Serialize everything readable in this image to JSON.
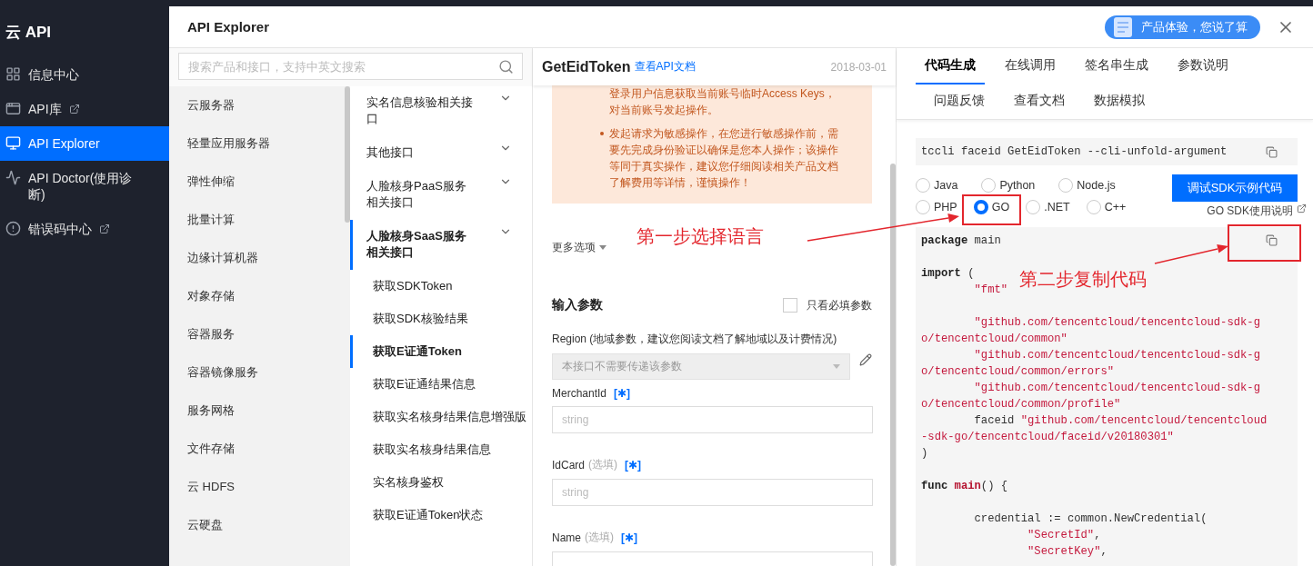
{
  "nav": {
    "title": "云 API",
    "items": [
      {
        "label": "信息中心",
        "external": false,
        "selected": false
      },
      {
        "label": "API库",
        "external": true,
        "selected": false
      },
      {
        "label": "API Explorer",
        "external": false,
        "selected": true
      },
      {
        "label": "API Doctor(使用诊断)",
        "external": false,
        "selected": false
      },
      {
        "label": "错误码中心",
        "external": true,
        "selected": false
      }
    ]
  },
  "header": {
    "title": "API Explorer",
    "banner": "产品体验，您说了算"
  },
  "search": {
    "placeholder": "搜索产品和接口，支持中英文搜索"
  },
  "products": [
    "云服务器",
    "轻量应用服务器",
    "弹性伸缩",
    "批量计算",
    "边缘计算机器",
    "对象存储",
    "容器服务",
    "容器镜像服务",
    "服务网格",
    "文件存储",
    "云 HDFS",
    "云硬盘"
  ],
  "api_groups": [
    {
      "label": "实名信息核验相关接口",
      "selected": false
    },
    {
      "label": "其他接口",
      "selected": false
    },
    {
      "label": "人脸核身PaaS服务相关接口",
      "selected": false
    },
    {
      "label": "人脸核身SaaS服务相关接口",
      "selected": true,
      "children": [
        {
          "label": "获取SDKToken",
          "selected": false
        },
        {
          "label": "获取SDK核验结果",
          "selected": false
        },
        {
          "label": "获取E证通Token",
          "selected": true
        },
        {
          "label": "获取E证通结果信息",
          "selected": false
        },
        {
          "label": "获取实名核身结果信息增强版",
          "selected": false
        },
        {
          "label": "获取实名核身结果信息",
          "selected": false
        },
        {
          "label": "实名核身鉴权",
          "selected": false
        },
        {
          "label": "获取E证通Token状态",
          "selected": false
        }
      ]
    }
  ],
  "api": {
    "name": "GetEidToken",
    "doc_link": "查看API文档",
    "date": "2018-03-01",
    "notices": [
      {
        "kind": "continued",
        "text": "登录用户信息获取当前账号临时Access Keys，对当前账号发起操作。"
      },
      {
        "kind": "bullet",
        "text": "发起请求为敏感操作，在您进行敏感操作前，需要先完成身份验证以确保是您本人操作；该操作等同于真实操作，建议您仔细阅读相关产品文档了解费用等详情，谨慎操作！"
      }
    ],
    "more_options": "更多选项",
    "params_title": "输入参数",
    "required_only": {
      "label": "只看必填参数",
      "checked": false
    },
    "region": {
      "label": "Region (地域参数，建议您阅读文档了解地域以及计费情况)",
      "value": "本接口不需要传递该参数",
      "disabled": true
    },
    "fields": [
      {
        "name": "MerchantId",
        "mark": "[✱]",
        "placeholder": "string"
      },
      {
        "name": "IdCard",
        "note": "(选填)",
        "mark": "[✱]",
        "placeholder": "string"
      },
      {
        "name": "Name",
        "note": "(选填)",
        "mark": "[✱]"
      }
    ]
  },
  "tab_rows": [
    [
      {
        "label": "代码生成",
        "selected": true
      },
      {
        "label": "在线调用",
        "selected": false
      },
      {
        "label": "签名串生成",
        "selected": false
      },
      {
        "label": "参数说明",
        "selected": false
      }
    ],
    [
      {
        "label": "问题反馈",
        "selected": false
      },
      {
        "label": "查看文档",
        "selected": false
      },
      {
        "label": "数据模拟",
        "selected": false
      }
    ]
  ],
  "cli_command": "tccli faceid GetEidToken --cli-unfold-argument",
  "language_rows": [
    [
      {
        "label": "Java",
        "selected": false
      },
      {
        "label": "Python",
        "selected": false
      },
      {
        "label": "Node.js",
        "selected": false
      }
    ],
    [
      {
        "label": "PHP",
        "selected": false
      },
      {
        "label": "GO",
        "selected": true
      },
      {
        "label": ".NET",
        "selected": false
      },
      {
        "label": "C++",
        "selected": false
      }
    ]
  ],
  "debug_button": "调试SDK示例代码",
  "sdk_doc_link": "GO SDK使用说明",
  "code_lines": [
    {
      "kind": "flush",
      "tokens": [
        {
          "kind": "keyword",
          "t": "package"
        },
        {
          "kind": "plain",
          "t": " main"
        }
      ]
    },
    {
      "kind": "blank"
    },
    {
      "kind": "flush",
      "tokens": [
        {
          "kind": "keyword",
          "t": "import"
        },
        {
          "kind": "plain",
          "t": " ("
        }
      ]
    },
    {
      "kind": "tab",
      "tokens": [
        {
          "kind": "string",
          "t": "\"fmt\""
        }
      ]
    },
    {
      "kind": "blank"
    },
    {
      "kind": "tab",
      "tokens": [
        {
          "kind": "string",
          "t": "\"github.com/tencentcloud/tencentcloud-sdk-g"
        }
      ]
    },
    {
      "kind": "flush",
      "tokens": [
        {
          "kind": "string",
          "t": "o/tencentcloud/common\""
        }
      ]
    },
    {
      "kind": "tab",
      "tokens": [
        {
          "kind": "string",
          "t": "\"github.com/tencentcloud/tencentcloud-sdk-g"
        }
      ]
    },
    {
      "kind": "flush",
      "tokens": [
        {
          "kind": "string",
          "t": "o/tencentcloud/common/errors\""
        }
      ]
    },
    {
      "kind": "tab",
      "tokens": [
        {
          "kind": "string",
          "t": "\"github.com/tencentcloud/tencentcloud-sdk-g"
        }
      ]
    },
    {
      "kind": "flush",
      "tokens": [
        {
          "kind": "string",
          "t": "o/tencentcloud/common/profile\""
        }
      ]
    },
    {
      "kind": "tab",
      "tokens": [
        {
          "kind": "plain",
          "t": "faceid "
        },
        {
          "kind": "string",
          "t": "\"github.com/tencentcloud/tencentcloud"
        }
      ]
    },
    {
      "kind": "flush",
      "tokens": [
        {
          "kind": "string",
          "t": "-sdk-go/tencentcloud/faceid/v20180301\""
        }
      ]
    },
    {
      "kind": "flush",
      "tokens": [
        {
          "kind": "plain",
          "t": ")"
        }
      ]
    },
    {
      "kind": "blank"
    },
    {
      "kind": "flush",
      "tokens": [
        {
          "kind": "keyword",
          "t": "func "
        },
        {
          "kind": "title",
          "t": "main"
        },
        {
          "kind": "plain",
          "t": "() {"
        }
      ]
    },
    {
      "kind": "blank"
    },
    {
      "kind": "tab",
      "tokens": [
        {
          "kind": "plain",
          "t": "credential := common.NewCredential("
        }
      ]
    },
    {
      "kind": "double_tab",
      "tokens": [
        {
          "kind": "string",
          "t": "\"SecretId\""
        },
        {
          "kind": "plain",
          "t": ","
        }
      ]
    },
    {
      "kind": "double_tab",
      "tokens": [
        {
          "kind": "string",
          "t": "\"SecretKey\""
        },
        {
          "kind": "plain",
          "t": ","
        }
      ]
    }
  ],
  "annotations": [
    {
      "text": "第一步选择语言"
    },
    {
      "text": "第二步复制代码"
    }
  ]
}
